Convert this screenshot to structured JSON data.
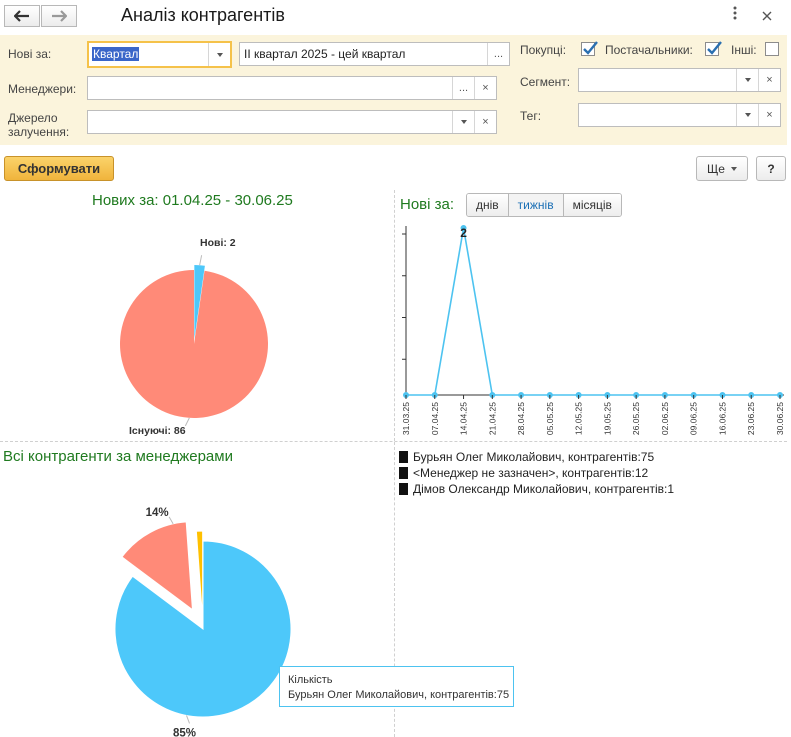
{
  "window": {
    "title": "Аналіз контрагентів",
    "more_icon": "vertical-dots-icon",
    "close_icon": "close-x-icon"
  },
  "filters": {
    "new_for": {
      "label": "Нові за:",
      "value": "Квартал",
      "period_value": "ІІ квартал 2025 - цей квартал"
    },
    "managers": {
      "label": "Менеджери:",
      "value": ""
    },
    "source": {
      "label_line1": "Джерело",
      "label_line2": "залучення:",
      "value": ""
    },
    "buyers": {
      "label": "Покупці:",
      "checked": true
    },
    "suppliers": {
      "label": "Постачальники:",
      "checked": true
    },
    "others": {
      "label": "Інші:",
      "checked": false
    },
    "segment": {
      "label": "Сегмент:",
      "value": ""
    },
    "tag": {
      "label": "Тег:",
      "value": ""
    },
    "ellipsis": "...",
    "clear": "×"
  },
  "toolbar": {
    "generate_label": "Сформувати",
    "more_label": "Ще",
    "help_label": "?"
  },
  "new_pie": {
    "title": "Нових за: 01.04.25 - 30.06.25",
    "new_label": "Нові: 2",
    "existing_label": "Існуючі: 86",
    "colors": {
      "existing": "#ff8a78",
      "new": "#4dc8fa"
    }
  },
  "new_chart_header": {
    "title": "Нові за:",
    "tabs": [
      {
        "label": "днів",
        "active": false
      },
      {
        "label": "тижнів",
        "active": true
      },
      {
        "label": "місяців",
        "active": false
      }
    ]
  },
  "managers_section": {
    "title": "Всі контрагенти за менеджерами",
    "legend": [
      "Бурьян Олег Миколайович, контрагентів:75",
      "<Менеджер не зазначен>, контрагентів:12",
      "Дімов Олександр Миколайович, контрагентів:1"
    ],
    "tooltip": {
      "line1": "Кількість",
      "line2": "Бурьян Олег Миколайович, контрагентів:75"
    }
  },
  "chart_data": [
    {
      "type": "pie",
      "title": "Нових за: 01.04.25 - 30.06.25",
      "categories": [
        "Існуючі",
        "Нові"
      ],
      "values": [
        86,
        2
      ],
      "colors": [
        "#ff8a78",
        "#4dc8fa"
      ]
    },
    {
      "type": "line",
      "title": "Нові за:",
      "x": [
        "31.03.25",
        "07.04.25",
        "14.04.25",
        "21.04.25",
        "28.04.25",
        "05.05.25",
        "12.05.25",
        "19.05.25",
        "26.05.25",
        "02.06.25",
        "09.06.25",
        "16.06.25",
        "23.06.25",
        "30.06.25"
      ],
      "values": [
        0,
        0,
        2,
        0,
        0,
        0,
        0,
        0,
        0,
        0,
        0,
        0,
        0,
        0
      ],
      "data_labels": [
        "",
        "",
        "2",
        "",
        "",
        "",
        "",
        "",
        "",
        "",
        "",
        "",
        "",
        ""
      ],
      "ylim": [
        0,
        2
      ],
      "color": "#4dc3f0",
      "grid": false
    },
    {
      "type": "pie",
      "title": "Всі контрагенти за менеджерами",
      "categories": [
        "Бурьян Олег Миколайович",
        "<Менеджер не зазначен>",
        "Дімов Олександр Миколайович"
      ],
      "values": [
        75,
        12,
        1
      ],
      "data_labels": [
        "85%",
        "14%",
        ""
      ],
      "colors": [
        "#4dc8fa",
        "#ff8a78",
        "#ffc000"
      ],
      "exploded": true
    }
  ]
}
